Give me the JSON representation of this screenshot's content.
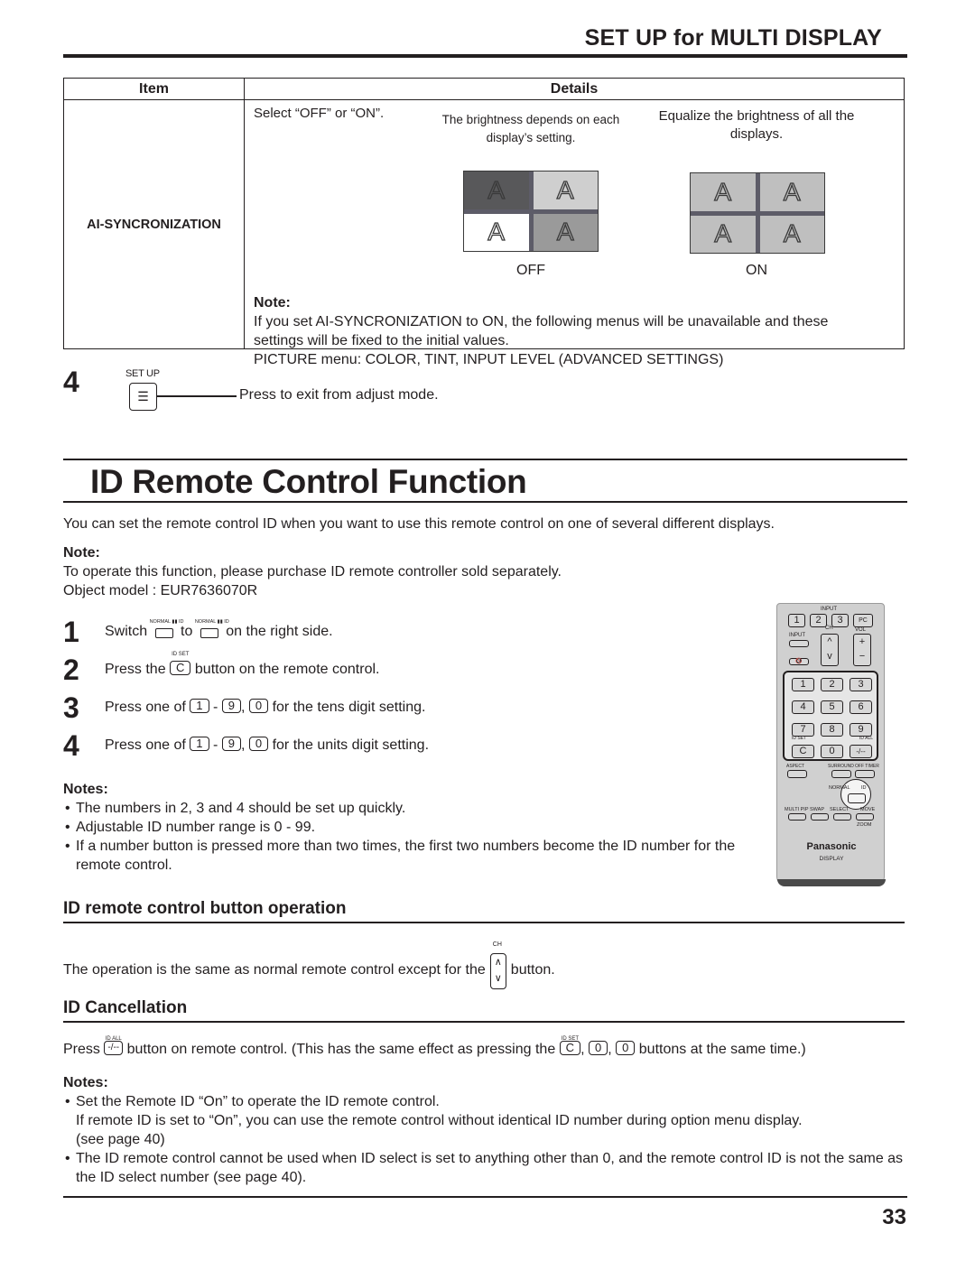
{
  "header": {
    "section_title": "SET UP for MULTI DISPLAY"
  },
  "table": {
    "col_item": "Item",
    "col_details": "Details",
    "item_name": "AI-SYNCRONIZATION",
    "select_text": "Select “OFF” or “ON”.",
    "off_desc": "The brightness depends on each display’s setting.",
    "on_desc": "Equalize the brightness of all the displays.",
    "display_letter": "A",
    "off_label": "OFF",
    "on_label": "ON",
    "off_cell_colors": [
      "#58585a",
      "#cfcfcf",
      "#ffffff",
      "#9a9a9a"
    ],
    "on_cell_color": "#bfbfbf",
    "note_label": "Note:",
    "note_lines": [
      "If you set AI-SYNCRONIZATION to ON, the following menus will be unavailable and these",
      "settings will be fixed to the initial values.",
      "PICTURE menu: COLOR, TINT, INPUT LEVEL (ADVANCED SETTINGS)"
    ]
  },
  "step4_setup": {
    "number": "4",
    "button_label": "SET UP",
    "button_glyph": "☰",
    "description": "Press to exit from adjust mode."
  },
  "main": {
    "title": "ID Remote Control Function",
    "intro": "You can set the remote control ID when you want to use this remote control on one of several different displays.",
    "note_label": "Note:",
    "note_lines": [
      "To operate this function, please purchase ID remote controller sold separately.",
      "Object model : EUR7636070R"
    ],
    "steps": [
      {
        "num": "1",
        "pre": "Switch",
        "mid": "to",
        "post": "on the right side.",
        "switch_label": "NORMAL ▮▮ ID"
      },
      {
        "num": "2",
        "pre": "Press the",
        "key": "C",
        "key_label": "ID SET",
        "post": "button on the remote control."
      },
      {
        "num": "3",
        "pre": "Press one of",
        "k1": "1",
        "dash": "-",
        "k2": "9",
        "comma": ",",
        "k3": "0",
        "post": "for the tens digit setting."
      },
      {
        "num": "4",
        "pre": "Press one of",
        "k1": "1",
        "dash": "-",
        "k2": "9",
        "comma": ",",
        "k3": "0",
        "post": "for the units digit setting."
      }
    ],
    "notes_label": "Notes:",
    "notes": [
      "The numbers in 2, 3 and 4 should be set up quickly.",
      "Adjustable ID number range is 0 - 99.",
      "If a number button is pressed more than two times, the first two numbers become the ID number for the remote control."
    ]
  },
  "remote": {
    "input_label": "INPUT",
    "top_buttons": [
      "1",
      "2",
      "3",
      "PC"
    ],
    "input_btn_label": "INPUT",
    "ch_label": "CH",
    "vol_label": "VOL",
    "ch_up": "^",
    "ch_down": "v",
    "vol_plus": "+",
    "vol_minus": "−",
    "numpad": [
      "1",
      "2",
      "3",
      "4",
      "5",
      "6",
      "7",
      "8",
      "9",
      "C",
      "0",
      "-/--"
    ],
    "id_set_label": "ID SET",
    "id_all_label": "ID ALL",
    "row_labels": [
      "ASPECT",
      "SURROUND",
      "OFF TIMER"
    ],
    "switch_label": "NORMAL",
    "switch_id": "ID",
    "bottom_labels": [
      "MULTI PIP",
      "SWAP",
      "SELECT",
      "MOVE"
    ],
    "zoom_label": "ZOOM",
    "brand": "Panasonic",
    "brand_sub": "DISPLAY"
  },
  "sub1": {
    "title": "ID remote control button operation",
    "pre": "The operation is the same as normal remote control except for the",
    "key_label": "CH",
    "post": "button."
  },
  "sub2": {
    "title": "ID Cancellation",
    "pre": "Press",
    "key1": "-/--",
    "key1_label": "ID ALL",
    "mid": "button on remote control. (This has the same effect as pressing the",
    "key2": "C",
    "key2_label": "ID SET",
    "key3": "0",
    "key4": "0",
    "post": "buttons at the same time.)",
    "notes_label": "Notes:",
    "notes": [
      {
        "text": "Set the Remote ID “On” to operate the ID remote control.",
        "cont": [
          "If remote ID is set to “On”, you can use the remote control without identical ID number during option menu display.",
          "(see page 40)"
        ]
      },
      {
        "text": "The ID remote control cannot be used when ID select is set to anything other than 0, and the remote control ID is not the same as the ID select number (see page 40).",
        "cont": []
      }
    ]
  },
  "footer": {
    "page_number": "33"
  }
}
